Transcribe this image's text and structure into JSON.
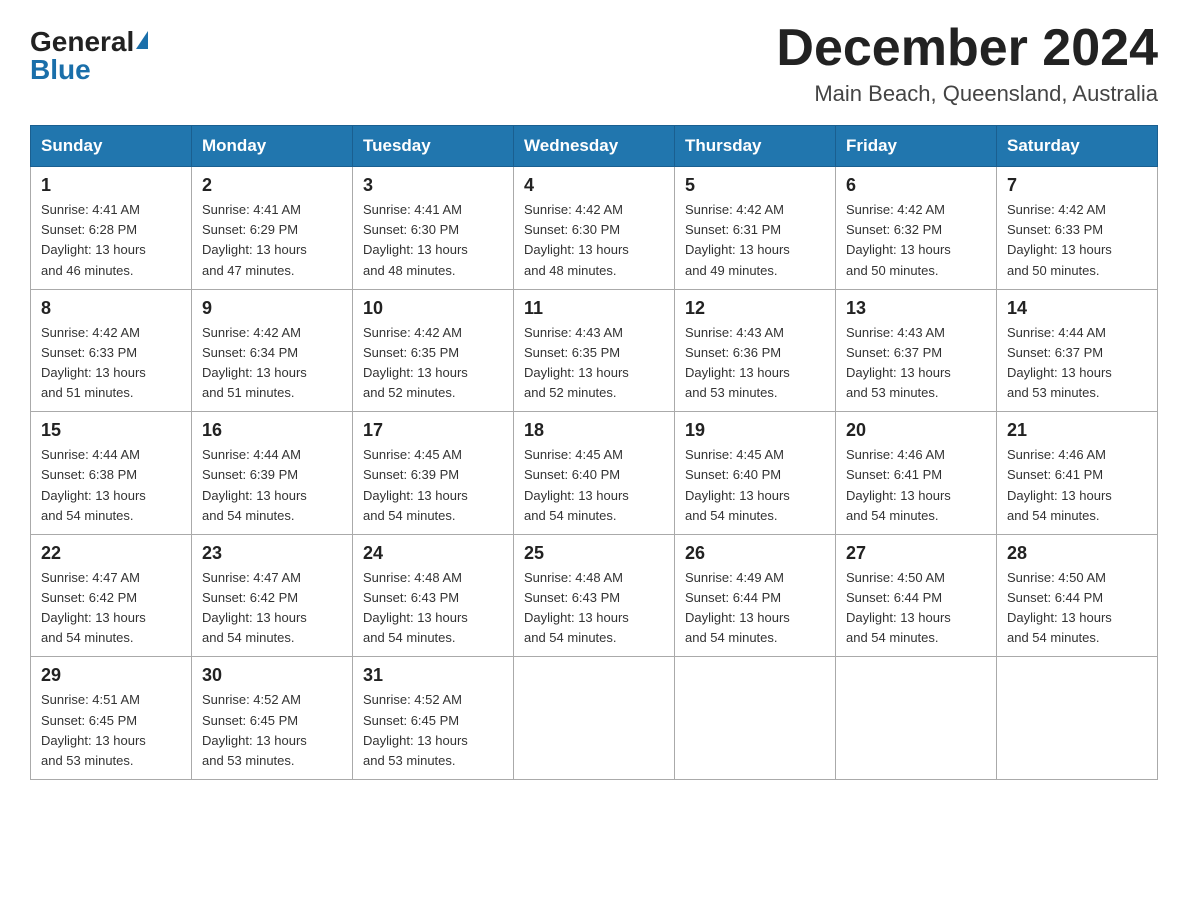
{
  "logo": {
    "general": "General",
    "blue": "Blue"
  },
  "title": "December 2024",
  "location": "Main Beach, Queensland, Australia",
  "weekdays": [
    "Sunday",
    "Monday",
    "Tuesday",
    "Wednesday",
    "Thursday",
    "Friday",
    "Saturday"
  ],
  "weeks": [
    [
      {
        "day": 1,
        "sunrise": "4:41 AM",
        "sunset": "6:28 PM",
        "daylight": "13 hours and 46 minutes."
      },
      {
        "day": 2,
        "sunrise": "4:41 AM",
        "sunset": "6:29 PM",
        "daylight": "13 hours and 47 minutes."
      },
      {
        "day": 3,
        "sunrise": "4:41 AM",
        "sunset": "6:30 PM",
        "daylight": "13 hours and 48 minutes."
      },
      {
        "day": 4,
        "sunrise": "4:42 AM",
        "sunset": "6:30 PM",
        "daylight": "13 hours and 48 minutes."
      },
      {
        "day": 5,
        "sunrise": "4:42 AM",
        "sunset": "6:31 PM",
        "daylight": "13 hours and 49 minutes."
      },
      {
        "day": 6,
        "sunrise": "4:42 AM",
        "sunset": "6:32 PM",
        "daylight": "13 hours and 50 minutes."
      },
      {
        "day": 7,
        "sunrise": "4:42 AM",
        "sunset": "6:33 PM",
        "daylight": "13 hours and 50 minutes."
      }
    ],
    [
      {
        "day": 8,
        "sunrise": "4:42 AM",
        "sunset": "6:33 PM",
        "daylight": "13 hours and 51 minutes."
      },
      {
        "day": 9,
        "sunrise": "4:42 AM",
        "sunset": "6:34 PM",
        "daylight": "13 hours and 51 minutes."
      },
      {
        "day": 10,
        "sunrise": "4:42 AM",
        "sunset": "6:35 PM",
        "daylight": "13 hours and 52 minutes."
      },
      {
        "day": 11,
        "sunrise": "4:43 AM",
        "sunset": "6:35 PM",
        "daylight": "13 hours and 52 minutes."
      },
      {
        "day": 12,
        "sunrise": "4:43 AM",
        "sunset": "6:36 PM",
        "daylight": "13 hours and 53 minutes."
      },
      {
        "day": 13,
        "sunrise": "4:43 AM",
        "sunset": "6:37 PM",
        "daylight": "13 hours and 53 minutes."
      },
      {
        "day": 14,
        "sunrise": "4:44 AM",
        "sunset": "6:37 PM",
        "daylight": "13 hours and 53 minutes."
      }
    ],
    [
      {
        "day": 15,
        "sunrise": "4:44 AM",
        "sunset": "6:38 PM",
        "daylight": "13 hours and 54 minutes."
      },
      {
        "day": 16,
        "sunrise": "4:44 AM",
        "sunset": "6:39 PM",
        "daylight": "13 hours and 54 minutes."
      },
      {
        "day": 17,
        "sunrise": "4:45 AM",
        "sunset": "6:39 PM",
        "daylight": "13 hours and 54 minutes."
      },
      {
        "day": 18,
        "sunrise": "4:45 AM",
        "sunset": "6:40 PM",
        "daylight": "13 hours and 54 minutes."
      },
      {
        "day": 19,
        "sunrise": "4:45 AM",
        "sunset": "6:40 PM",
        "daylight": "13 hours and 54 minutes."
      },
      {
        "day": 20,
        "sunrise": "4:46 AM",
        "sunset": "6:41 PM",
        "daylight": "13 hours and 54 minutes."
      },
      {
        "day": 21,
        "sunrise": "4:46 AM",
        "sunset": "6:41 PM",
        "daylight": "13 hours and 54 minutes."
      }
    ],
    [
      {
        "day": 22,
        "sunrise": "4:47 AM",
        "sunset": "6:42 PM",
        "daylight": "13 hours and 54 minutes."
      },
      {
        "day": 23,
        "sunrise": "4:47 AM",
        "sunset": "6:42 PM",
        "daylight": "13 hours and 54 minutes."
      },
      {
        "day": 24,
        "sunrise": "4:48 AM",
        "sunset": "6:43 PM",
        "daylight": "13 hours and 54 minutes."
      },
      {
        "day": 25,
        "sunrise": "4:48 AM",
        "sunset": "6:43 PM",
        "daylight": "13 hours and 54 minutes."
      },
      {
        "day": 26,
        "sunrise": "4:49 AM",
        "sunset": "6:44 PM",
        "daylight": "13 hours and 54 minutes."
      },
      {
        "day": 27,
        "sunrise": "4:50 AM",
        "sunset": "6:44 PM",
        "daylight": "13 hours and 54 minutes."
      },
      {
        "day": 28,
        "sunrise": "4:50 AM",
        "sunset": "6:44 PM",
        "daylight": "13 hours and 54 minutes."
      }
    ],
    [
      {
        "day": 29,
        "sunrise": "4:51 AM",
        "sunset": "6:45 PM",
        "daylight": "13 hours and 53 minutes."
      },
      {
        "day": 30,
        "sunrise": "4:52 AM",
        "sunset": "6:45 PM",
        "daylight": "13 hours and 53 minutes."
      },
      {
        "day": 31,
        "sunrise": "4:52 AM",
        "sunset": "6:45 PM",
        "daylight": "13 hours and 53 minutes."
      },
      null,
      null,
      null,
      null
    ]
  ]
}
